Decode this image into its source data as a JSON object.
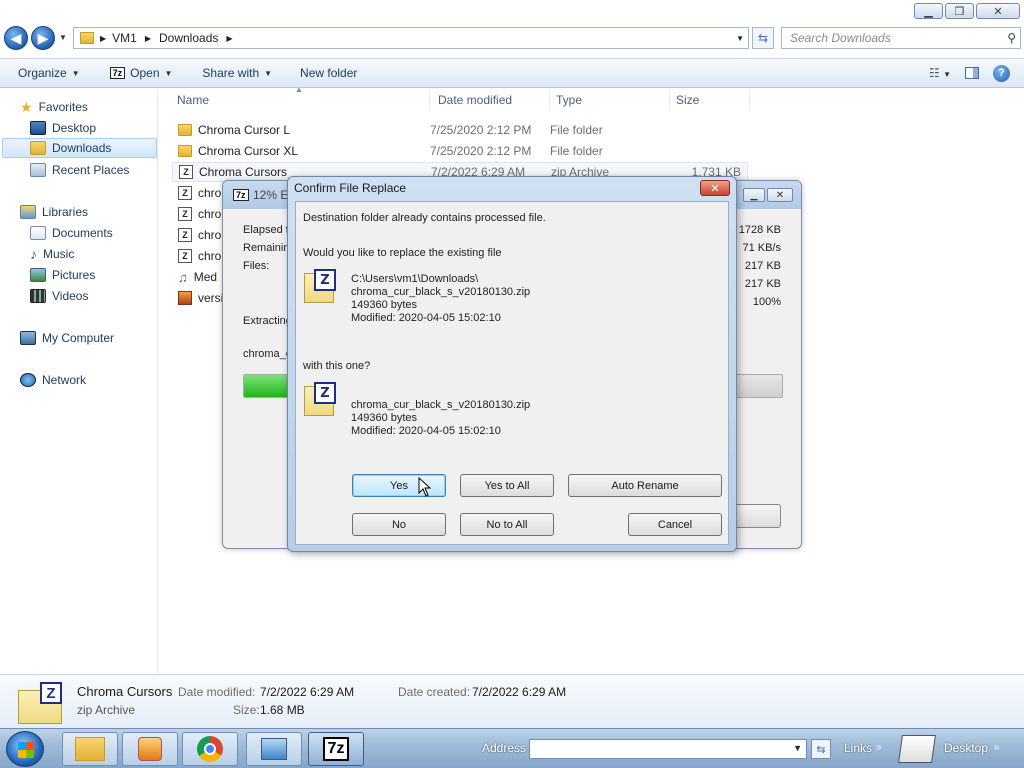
{
  "window": {
    "minimize": "▁",
    "maximize": "❐",
    "close": "✕"
  },
  "nav": {
    "back": "◀",
    "forward": "▶",
    "breadcrumb": [
      "VM1",
      "Downloads"
    ],
    "search_placeholder": "Search Downloads"
  },
  "toolbar": {
    "organize": "Organize",
    "open": "Open",
    "share_with": "Share with",
    "new_folder": "New folder"
  },
  "sidebar": {
    "favorites": "Favorites",
    "desktop": "Desktop",
    "downloads": "Downloads",
    "recent_places": "Recent Places",
    "libraries": "Libraries",
    "documents": "Documents",
    "music": "Music",
    "pictures": "Pictures",
    "videos": "Videos",
    "my_computer": "My Computer",
    "network": "Network"
  },
  "columns": {
    "name": "Name",
    "date_modified": "Date modified",
    "type": "Type",
    "size": "Size"
  },
  "files": [
    {
      "name": "Chroma Cursor L",
      "date": "7/25/2020 2:12 PM",
      "type": "File folder",
      "size": "",
      "kind": "folder"
    },
    {
      "name": "Chroma Cursor XL",
      "date": "7/25/2020 2:12 PM",
      "type": "File folder",
      "size": "",
      "kind": "folder"
    },
    {
      "name": "Chroma Cursors",
      "date": "7/2/2022 6:29 AM",
      "type": "zip Archive",
      "size": "1,731 KB",
      "kind": "zip"
    },
    {
      "name": "chro",
      "kind": "zip"
    },
    {
      "name": "chro",
      "kind": "zip"
    },
    {
      "name": "chro",
      "kind": "zip"
    },
    {
      "name": "chro",
      "kind": "zip"
    },
    {
      "name": "Med",
      "kind": "media"
    },
    {
      "name": "versi",
      "kind": "other"
    }
  ],
  "progress_window": {
    "title": "12% Ex",
    "elapsed_label": "Elapsed ti",
    "remaining_label": "Remaining",
    "files_label": "Files:",
    "extracting_label": "Extracting",
    "current_file": "chroma_c",
    "values": [
      "1728 KB",
      "71 KB/s",
      "217 KB",
      "217 KB",
      "100%"
    ],
    "progress_fraction": 0.12
  },
  "dialog": {
    "title": "Confirm File Replace",
    "close": "✕",
    "line1": "Destination folder already contains processed file.",
    "line2": "Would you like to replace the existing file",
    "existing": {
      "path": "C:\\Users\\vm1\\Downloads\\",
      "name": "chroma_cur_black_s_v20180130.zip",
      "size": "149360 bytes",
      "modified": "Modified: 2020-04-05 15:02:10"
    },
    "with_this": "with this one?",
    "new": {
      "name": "chroma_cur_black_s_v20180130.zip",
      "size": "149360 bytes",
      "modified": "Modified: 2020-04-05 15:02:10"
    },
    "buttons": {
      "yes": "Yes",
      "yes_to_all": "Yes to All",
      "auto_rename": "Auto Rename",
      "no": "No",
      "no_to_all": "No to All",
      "cancel": "Cancel"
    }
  },
  "details": {
    "name": "Chroma Cursors",
    "type": "zip Archive",
    "date_modified_label": "Date modified:",
    "date_modified": "7/2/2022 6:29 AM",
    "date_created_label": "Date created:",
    "date_created": "7/2/2022 6:29 AM",
    "size_label": "Size:",
    "size": "1.68 MB"
  },
  "taskbar": {
    "address_label": "Address",
    "links_label": "Links",
    "desktop_label": "Desktop"
  }
}
